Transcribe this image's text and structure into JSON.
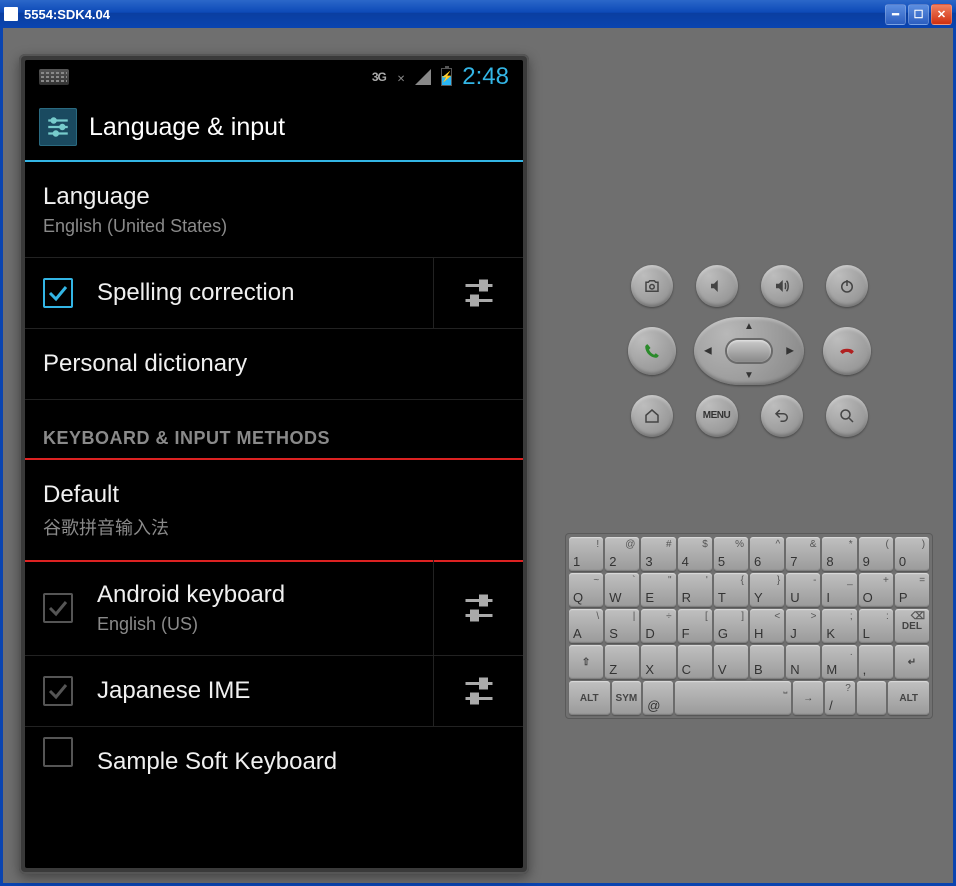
{
  "window": {
    "title": "5554:SDK4.04"
  },
  "statusbar": {
    "network": "3G",
    "net_x": "✕",
    "clock": "2:48"
  },
  "header": {
    "title": "Language & input"
  },
  "settings": {
    "language": {
      "title": "Language",
      "sub": "English (United States)"
    },
    "spelling": {
      "title": "Spelling correction",
      "checked": true
    },
    "personal_dict": {
      "title": "Personal dictionary"
    },
    "section": "KEYBOARD & INPUT METHODS",
    "default": {
      "title": "Default",
      "sub": "谷歌拼音输入法"
    },
    "android_kb": {
      "title": "Android keyboard",
      "sub": "English (US)"
    },
    "japanese": {
      "title": "Japanese IME"
    },
    "sample": {
      "title": "Sample Soft Keyboard"
    }
  },
  "controls": {
    "menu_label": "MENU"
  },
  "keyboard": {
    "row1": [
      {
        "main": "1",
        "alt": "!"
      },
      {
        "main": "2",
        "alt": "@"
      },
      {
        "main": "3",
        "alt": "#"
      },
      {
        "main": "4",
        "alt": "$"
      },
      {
        "main": "5",
        "alt": "%"
      },
      {
        "main": "6",
        "alt": "^"
      },
      {
        "main": "7",
        "alt": "&"
      },
      {
        "main": "8",
        "alt": "*"
      },
      {
        "main": "9",
        "alt": "("
      },
      {
        "main": "0",
        "alt": ")"
      }
    ],
    "row2": [
      {
        "main": "Q",
        "alt": "~"
      },
      {
        "main": "W",
        "alt": "`"
      },
      {
        "main": "E",
        "alt": "\""
      },
      {
        "main": "R",
        "alt": "'"
      },
      {
        "main": "T",
        "alt": "{"
      },
      {
        "main": "Y",
        "alt": "}"
      },
      {
        "main": "U",
        "alt": "-"
      },
      {
        "main": "I",
        "alt": "_"
      },
      {
        "main": "O",
        "alt": "+"
      },
      {
        "main": "P",
        "alt": "="
      }
    ],
    "row3": [
      {
        "main": "A",
        "alt": "\\"
      },
      {
        "main": "S",
        "alt": "|"
      },
      {
        "main": "D",
        "alt": "÷"
      },
      {
        "main": "F",
        "alt": "["
      },
      {
        "main": "G",
        "alt": "]"
      },
      {
        "main": "H",
        "alt": "<"
      },
      {
        "main": "J",
        "alt": ">"
      },
      {
        "main": "K",
        "alt": ";"
      },
      {
        "main": "L",
        "alt": ":"
      },
      {
        "main": "DEL",
        "alt": "⌫",
        "fn": true
      }
    ],
    "row4": [
      {
        "main": "⇧",
        "fn": true
      },
      {
        "main": "Z",
        "alt": ""
      },
      {
        "main": "X",
        "alt": ""
      },
      {
        "main": "C",
        "alt": ""
      },
      {
        "main": "V",
        "alt": ""
      },
      {
        "main": "B",
        "alt": ""
      },
      {
        "main": "N",
        "alt": ""
      },
      {
        "main": "M",
        "alt": "."
      },
      {
        "main": ",",
        "alt": ""
      },
      {
        "main": "↵",
        "fn": true
      }
    ],
    "row5": [
      {
        "main": "ALT",
        "fn": true,
        "wide": true
      },
      {
        "main": "SYM",
        "fn": true
      },
      {
        "main": "@",
        "alt": ""
      },
      {
        "main": "",
        "space": true,
        "alt": "⎵"
      },
      {
        "main": "→",
        "fn": true
      },
      {
        "main": "/",
        "alt": "?"
      },
      {
        "main": "",
        "alt": ""
      },
      {
        "main": "ALT",
        "fn": true,
        "wide": true
      }
    ]
  }
}
